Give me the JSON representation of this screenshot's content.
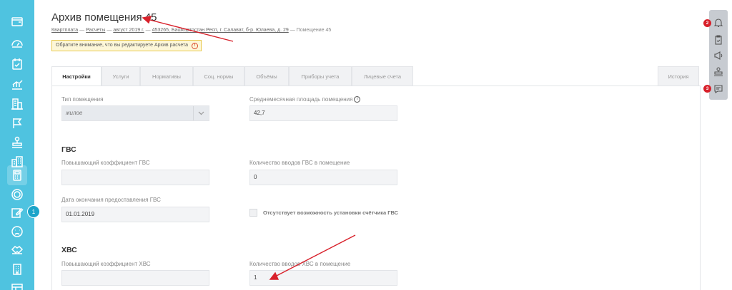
{
  "sidebar": {
    "items": [
      {
        "icon": "wallet-icon"
      },
      {
        "icon": "gauge-icon"
      },
      {
        "icon": "calendar-check-icon"
      },
      {
        "icon": "chart-icon"
      },
      {
        "icon": "buildings-icon"
      },
      {
        "icon": "flag-icon"
      },
      {
        "icon": "stamp-icon"
      },
      {
        "icon": "city-icon"
      },
      {
        "icon": "calculator-icon",
        "active": true
      },
      {
        "icon": "coin-icon"
      },
      {
        "icon": "edit-icon",
        "badge": "1"
      },
      {
        "icon": "sad-face-icon"
      },
      {
        "icon": "handshake-icon"
      },
      {
        "icon": "office-icon"
      },
      {
        "icon": "table-icon"
      }
    ]
  },
  "header": {
    "title": "Архив помещения 45",
    "breadcrumb": {
      "items": [
        "Квартплата",
        "Расчеты",
        "август 2019 г.",
        "453265, Башкортостан Респ, г. Салават, б-р. Юлаева, д. 29",
        "Помещение 45"
      ],
      "separator": "—"
    },
    "warning": "Обратите внимание, что вы редактируете Архив расчета"
  },
  "tabs": {
    "items": [
      "Настройки",
      "Услуги",
      "Нормативы",
      "Соц. нормы",
      "Объёмы",
      "Приборы учета",
      "Лицевые счета"
    ],
    "history": "История"
  },
  "form": {
    "room_type": {
      "label": "Тип помещения",
      "value": "жилое"
    },
    "avg_area": {
      "label": "Среднемесячная площадь помещения",
      "value": "42,7"
    },
    "hot_water": {
      "section": "ГВС",
      "coef_label": "Повышающий коэффициент ГВС",
      "coef_value": "",
      "inputs_label": "Количество вводов ГВС в помещение",
      "inputs_value": "0",
      "end_date_label": "Дата окончания предоставления ГВС",
      "end_date_value": "01.01.2019",
      "no_meter_label": "Отсутствует возможность установки счётчика ГВС"
    },
    "cold_water": {
      "section": "ХВС",
      "coef_label": "Повышающий коэффициент ХВС",
      "coef_value": "",
      "inputs_label": "Количество вводов ХВС в помещение",
      "inputs_value": "1"
    }
  },
  "right_panel": {
    "items": [
      {
        "icon": "bell-icon",
        "badge": "2"
      },
      {
        "icon": "clipboard-icon"
      },
      {
        "icon": "megaphone-icon"
      },
      {
        "icon": "stamp-icon"
      },
      {
        "icon": "chat-icon",
        "badge": "3"
      }
    ]
  },
  "colors": {
    "sidebar": "#4fc3e0",
    "badge_red": "#d8202a",
    "annotation_arrow": "#d8202a",
    "warning_bg": "#fdf7d8"
  }
}
